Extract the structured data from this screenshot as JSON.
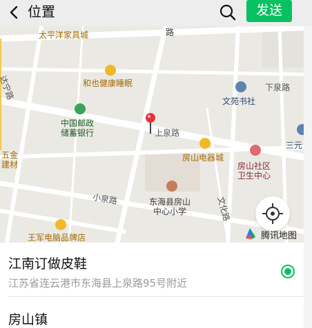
{
  "header": {
    "title": "位置",
    "send_label": "发送"
  },
  "map": {
    "labels": {
      "taiping": "太平洋家具城",
      "hetai": "和也健康睡眠",
      "postal_1": "中国邮政",
      "postal_2": "储蓄银行",
      "wenyuan": "文苑书社",
      "xiaquan": "下泉路",
      "shangquan": "上泉路",
      "xiaoquan": "小泉路",
      "fangshan_elec": "房山电器城",
      "clinic_1": "房山社区",
      "clinic_2": "卫生中心",
      "school_1": "东海县房山",
      "school_2": "中心小学",
      "wenhua": "文化路",
      "wangjun": "王军电脑品牌店",
      "wujin_1": "五金",
      "wujin_2": "建材",
      "daning": "达宁路",
      "sanyuan": "三元",
      "road_top": "路"
    },
    "watermark": "腾讯地图"
  },
  "results": [
    {
      "title": "江南订做皮鞋",
      "address": "江苏省连云港市东海县上泉路95号附近",
      "selected": true
    },
    {
      "title": "房山镇",
      "address": "",
      "selected": false
    }
  ],
  "colors": {
    "accent": "#07c160",
    "pin": "#e8323c"
  }
}
